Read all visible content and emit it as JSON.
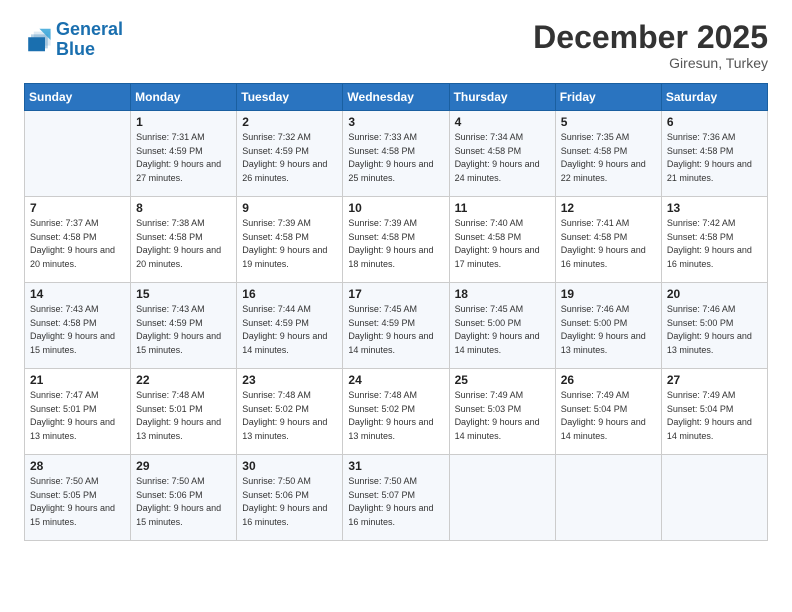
{
  "logo": {
    "line1": "General",
    "line2": "Blue"
  },
  "title": "December 2025",
  "location": "Giresun, Turkey",
  "days_header": [
    "Sunday",
    "Monday",
    "Tuesday",
    "Wednesday",
    "Thursday",
    "Friday",
    "Saturday"
  ],
  "weeks": [
    [
      {
        "day": "",
        "info": ""
      },
      {
        "day": "1",
        "info": "Sunrise: 7:31 AM\nSunset: 4:59 PM\nDaylight: 9 hours\nand 27 minutes."
      },
      {
        "day": "2",
        "info": "Sunrise: 7:32 AM\nSunset: 4:59 PM\nDaylight: 9 hours\nand 26 minutes."
      },
      {
        "day": "3",
        "info": "Sunrise: 7:33 AM\nSunset: 4:58 PM\nDaylight: 9 hours\nand 25 minutes."
      },
      {
        "day": "4",
        "info": "Sunrise: 7:34 AM\nSunset: 4:58 PM\nDaylight: 9 hours\nand 24 minutes."
      },
      {
        "day": "5",
        "info": "Sunrise: 7:35 AM\nSunset: 4:58 PM\nDaylight: 9 hours\nand 22 minutes."
      },
      {
        "day": "6",
        "info": "Sunrise: 7:36 AM\nSunset: 4:58 PM\nDaylight: 9 hours\nand 21 minutes."
      }
    ],
    [
      {
        "day": "7",
        "info": "Sunrise: 7:37 AM\nSunset: 4:58 PM\nDaylight: 9 hours\nand 20 minutes."
      },
      {
        "day": "8",
        "info": "Sunrise: 7:38 AM\nSunset: 4:58 PM\nDaylight: 9 hours\nand 20 minutes."
      },
      {
        "day": "9",
        "info": "Sunrise: 7:39 AM\nSunset: 4:58 PM\nDaylight: 9 hours\nand 19 minutes."
      },
      {
        "day": "10",
        "info": "Sunrise: 7:39 AM\nSunset: 4:58 PM\nDaylight: 9 hours\nand 18 minutes."
      },
      {
        "day": "11",
        "info": "Sunrise: 7:40 AM\nSunset: 4:58 PM\nDaylight: 9 hours\nand 17 minutes."
      },
      {
        "day": "12",
        "info": "Sunrise: 7:41 AM\nSunset: 4:58 PM\nDaylight: 9 hours\nand 16 minutes."
      },
      {
        "day": "13",
        "info": "Sunrise: 7:42 AM\nSunset: 4:58 PM\nDaylight: 9 hours\nand 16 minutes."
      }
    ],
    [
      {
        "day": "14",
        "info": "Sunrise: 7:43 AM\nSunset: 4:58 PM\nDaylight: 9 hours\nand 15 minutes."
      },
      {
        "day": "15",
        "info": "Sunrise: 7:43 AM\nSunset: 4:59 PM\nDaylight: 9 hours\nand 15 minutes."
      },
      {
        "day": "16",
        "info": "Sunrise: 7:44 AM\nSunset: 4:59 PM\nDaylight: 9 hours\nand 14 minutes."
      },
      {
        "day": "17",
        "info": "Sunrise: 7:45 AM\nSunset: 4:59 PM\nDaylight: 9 hours\nand 14 minutes."
      },
      {
        "day": "18",
        "info": "Sunrise: 7:45 AM\nSunset: 5:00 PM\nDaylight: 9 hours\nand 14 minutes."
      },
      {
        "day": "19",
        "info": "Sunrise: 7:46 AM\nSunset: 5:00 PM\nDaylight: 9 hours\nand 13 minutes."
      },
      {
        "day": "20",
        "info": "Sunrise: 7:46 AM\nSunset: 5:00 PM\nDaylight: 9 hours\nand 13 minutes."
      }
    ],
    [
      {
        "day": "21",
        "info": "Sunrise: 7:47 AM\nSunset: 5:01 PM\nDaylight: 9 hours\nand 13 minutes."
      },
      {
        "day": "22",
        "info": "Sunrise: 7:48 AM\nSunset: 5:01 PM\nDaylight: 9 hours\nand 13 minutes."
      },
      {
        "day": "23",
        "info": "Sunrise: 7:48 AM\nSunset: 5:02 PM\nDaylight: 9 hours\nand 13 minutes."
      },
      {
        "day": "24",
        "info": "Sunrise: 7:48 AM\nSunset: 5:02 PM\nDaylight: 9 hours\nand 13 minutes."
      },
      {
        "day": "25",
        "info": "Sunrise: 7:49 AM\nSunset: 5:03 PM\nDaylight: 9 hours\nand 14 minutes."
      },
      {
        "day": "26",
        "info": "Sunrise: 7:49 AM\nSunset: 5:04 PM\nDaylight: 9 hours\nand 14 minutes."
      },
      {
        "day": "27",
        "info": "Sunrise: 7:49 AM\nSunset: 5:04 PM\nDaylight: 9 hours\nand 14 minutes."
      }
    ],
    [
      {
        "day": "28",
        "info": "Sunrise: 7:50 AM\nSunset: 5:05 PM\nDaylight: 9 hours\nand 15 minutes."
      },
      {
        "day": "29",
        "info": "Sunrise: 7:50 AM\nSunset: 5:06 PM\nDaylight: 9 hours\nand 15 minutes."
      },
      {
        "day": "30",
        "info": "Sunrise: 7:50 AM\nSunset: 5:06 PM\nDaylight: 9 hours\nand 16 minutes."
      },
      {
        "day": "31",
        "info": "Sunrise: 7:50 AM\nSunset: 5:07 PM\nDaylight: 9 hours\nand 16 minutes."
      },
      {
        "day": "",
        "info": ""
      },
      {
        "day": "",
        "info": ""
      },
      {
        "day": "",
        "info": ""
      }
    ]
  ]
}
